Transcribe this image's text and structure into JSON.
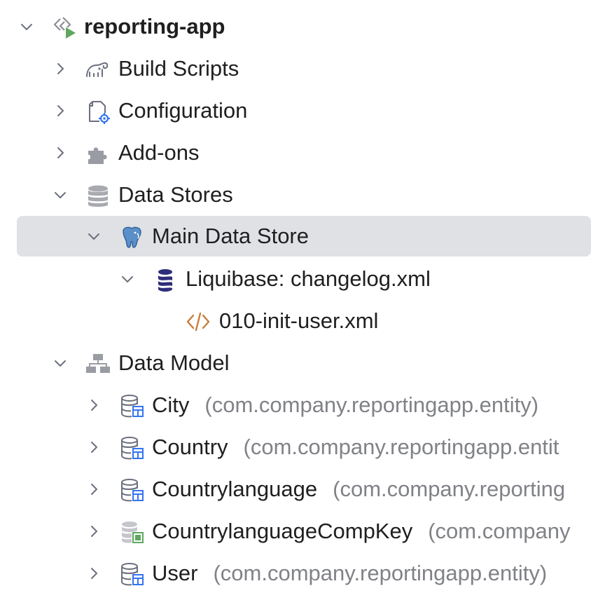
{
  "tree": {
    "root": {
      "label": "reporting-app",
      "expanded": true,
      "icon": "module-run-icon"
    },
    "build_scripts": {
      "label": "Build Scripts",
      "expanded": false,
      "icon": "gradle-elephant-icon"
    },
    "configuration": {
      "label": "Configuration",
      "expanded": false,
      "icon": "config-file-icon"
    },
    "addons": {
      "label": "Add-ons",
      "expanded": false,
      "icon": "puzzle-icon"
    },
    "data_stores": {
      "label": "Data Stores",
      "expanded": true,
      "icon": "database-icon"
    },
    "main_data_store": {
      "label": "Main Data Store",
      "expanded": true,
      "selected": true,
      "icon": "postgresql-elephant-icon"
    },
    "liquibase": {
      "label": "Liquibase: changelog.xml",
      "expanded": true,
      "icon": "liquibase-icon"
    },
    "changeset": {
      "label": "010-init-user.xml",
      "icon": "xml-file-icon"
    },
    "data_model": {
      "label": "Data Model",
      "expanded": true,
      "icon": "hierarchy-icon"
    },
    "entities": [
      {
        "name": "City",
        "package": "(com.company.reportingapp.entity)",
        "icon": "entity-icon"
      },
      {
        "name": "Country",
        "package": "(com.company.reportingapp.entit",
        "icon": "entity-icon"
      },
      {
        "name": "Countrylanguage",
        "package": "(com.company.reporting",
        "icon": "entity-icon"
      },
      {
        "name": "CountrylanguageCompKey",
        "package": "(com.company",
        "icon": "embeddable-entity-icon"
      },
      {
        "name": "User",
        "package": "(com.company.reportingapp.entity)",
        "icon": "entity-icon"
      }
    ]
  },
  "colors": {
    "selection_bg": "#dfe1e5",
    "text": "#1f1f1f",
    "package_text": "#808287",
    "chevron": "#6c707e",
    "run_green": "#5fa760",
    "entity_blue": "#3574f0",
    "liquibase_navy": "#2d2d7a",
    "xml_orange": "#c77d3a"
  }
}
